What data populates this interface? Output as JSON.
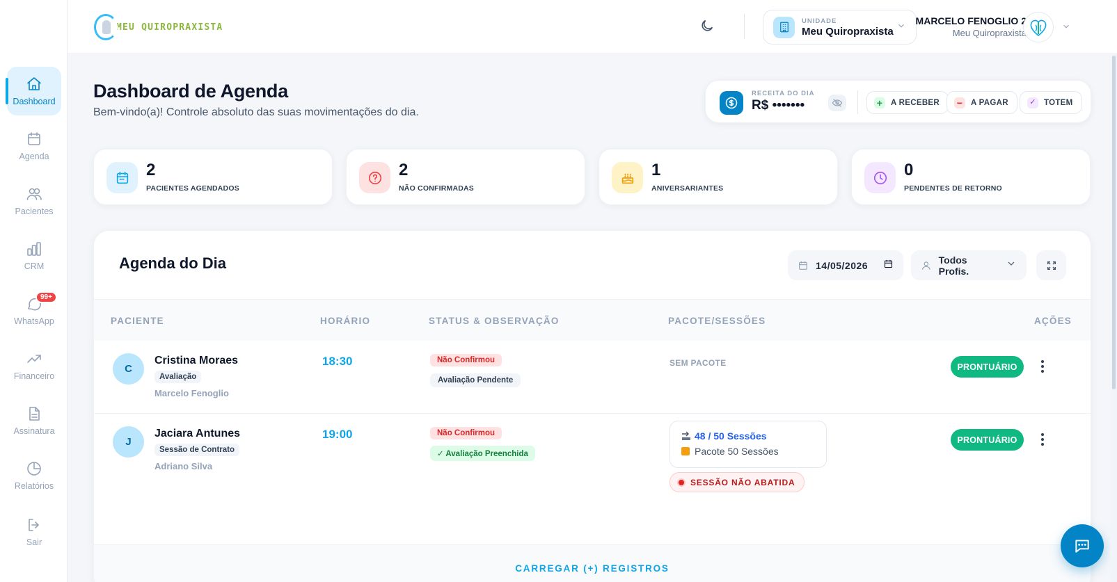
{
  "sidebar": {
    "items": [
      {
        "label": "Dashboard",
        "icon": "home-icon"
      },
      {
        "label": "Agenda",
        "icon": "calendar-icon"
      },
      {
        "label": "Pacientes",
        "icon": "users-icon"
      },
      {
        "label": "CRM",
        "icon": "bar-chart-icon"
      },
      {
        "label": "WhatsApp",
        "icon": "chat-bubble-icon",
        "badge": "99+"
      },
      {
        "label": "Financeiro",
        "icon": "trending-up-icon"
      },
      {
        "label": "Assinatura",
        "icon": "document-icon"
      },
      {
        "label": "Relatórios",
        "icon": "pie-chart-icon"
      },
      {
        "label": "Sair",
        "icon": "logout-icon"
      }
    ]
  },
  "header": {
    "logo_text": "MEU QUIROPRAXISTA",
    "unit": {
      "label": "UNIDADE",
      "name": "Meu Quiropraxista"
    },
    "user": {
      "name": "MARCELO FENOGLIO 2",
      "clinic": "Meu Quiropraxista"
    }
  },
  "page": {
    "title": "Dashboard de Agenda",
    "subtitle": "Bem-vindo(a)! Controle absoluto das suas movimentações do dia."
  },
  "revenue": {
    "label": "RECEITA DO DIA",
    "value": "R$ •••••••",
    "buttons": {
      "receive": "A RECEBER",
      "pay": "A PAGAR",
      "totem": "TOTEM"
    }
  },
  "stats": [
    {
      "value": "2",
      "label": "PACIENTES AGENDADOS",
      "icon": "calendar-icon",
      "color": "#0ea5e9"
    },
    {
      "value": "2",
      "label": "NÃO CONFIRMADAS",
      "icon": "question-circle-icon",
      "color": "#ef4444"
    },
    {
      "value": "1",
      "label": "ANIVERSARIANTES",
      "icon": "cake-icon",
      "color": "#f59e0b"
    },
    {
      "value": "0",
      "label": "PENDENTES DE RETORNO",
      "icon": "clock-icon",
      "color": "#a855f7"
    }
  ],
  "agenda": {
    "title": "Agenda do Dia",
    "date": "14/05/2026",
    "professional_filter": "Todos Profis.",
    "columns": [
      "PACIENTE",
      "HORÁRIO",
      "STATUS & OBSERVAÇÃO",
      "PACOTE/SESSÕES",
      "AÇÕES"
    ],
    "rows": [
      {
        "initial": "C",
        "name": "Cristina Moraes",
        "type": "Avaliação",
        "professional": "Marcelo Fenoglio",
        "time": "18:30",
        "status": "Não Confirmou",
        "observation": "Avaliação Pendente",
        "package": "SEM PACOTE",
        "action": "PRONTUÁRIO"
      },
      {
        "initial": "J",
        "name": "Jaciara Antunes",
        "type": "Sessão de Contrato",
        "professional": "Adriano Silva",
        "time": "19:00",
        "status": "Não Confirmou",
        "observation": "✓ Avaliação Preenchida",
        "package_sessions": "48 / 50 Sessões",
        "package_name": "Pacote 50 Sessões",
        "warning": "SESSÃO NÃO ABATIDA",
        "action": "PRONTUÁRIO"
      }
    ],
    "load_more": "CARREGAR (+) REGISTROS"
  },
  "colors": {
    "primary": "#0284c7",
    "accent": "#0ea5e9",
    "success": "#10b981",
    "danger": "#dc2626",
    "logo_green": "#8ab83b"
  }
}
